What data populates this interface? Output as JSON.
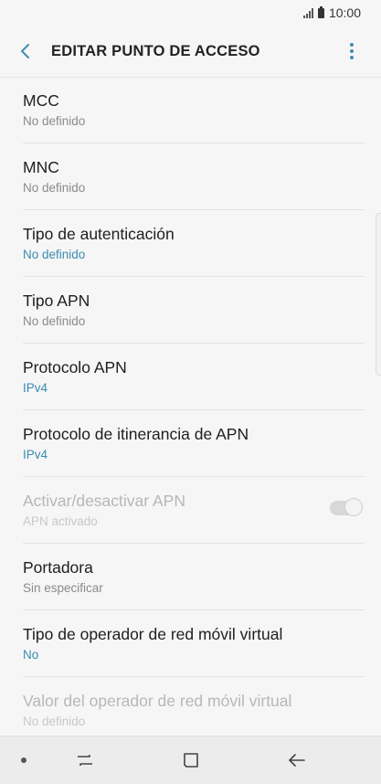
{
  "status_bar": {
    "time": "10:00"
  },
  "header": {
    "title": "EDITAR PUNTO DE ACCESO",
    "back_icon": "back-arrow-icon",
    "more_icon": "more-vertical-icon"
  },
  "colors": {
    "accent": "#3a8bb0",
    "background": "#f6f6f6",
    "disabled_text": "#b7b7b7"
  },
  "settings": [
    {
      "title": "MCC",
      "value": "No definido",
      "value_style": "default"
    },
    {
      "title": "MNC",
      "value": "No definido",
      "value_style": "default"
    },
    {
      "title": "Tipo de autenticación",
      "value": "No definido",
      "value_style": "accent"
    },
    {
      "title": "Tipo APN",
      "value": "No definido",
      "value_style": "default"
    },
    {
      "title": "Protocolo APN",
      "value": "IPv4",
      "value_style": "accent"
    },
    {
      "title": "Protocolo de itinerancia de APN",
      "value": "IPv4",
      "value_style": "accent"
    },
    {
      "title": "Activar/desactivar APN",
      "value": "APN activado",
      "value_style": "disabled",
      "toggle_on": true
    },
    {
      "title": "Portadora",
      "value": "Sin especificar",
      "value_style": "default"
    },
    {
      "title": "Tipo de operador de red móvil virtual",
      "value": "No",
      "value_style": "accent"
    },
    {
      "title": "Valor del operador de red móvil virtual",
      "value": "No definido",
      "value_style": "disabled"
    }
  ],
  "nav_bar": {
    "dot_icon": "dot-icon",
    "recents_icon": "recents-icon",
    "home_icon": "home-icon",
    "back_icon": "back-icon"
  }
}
